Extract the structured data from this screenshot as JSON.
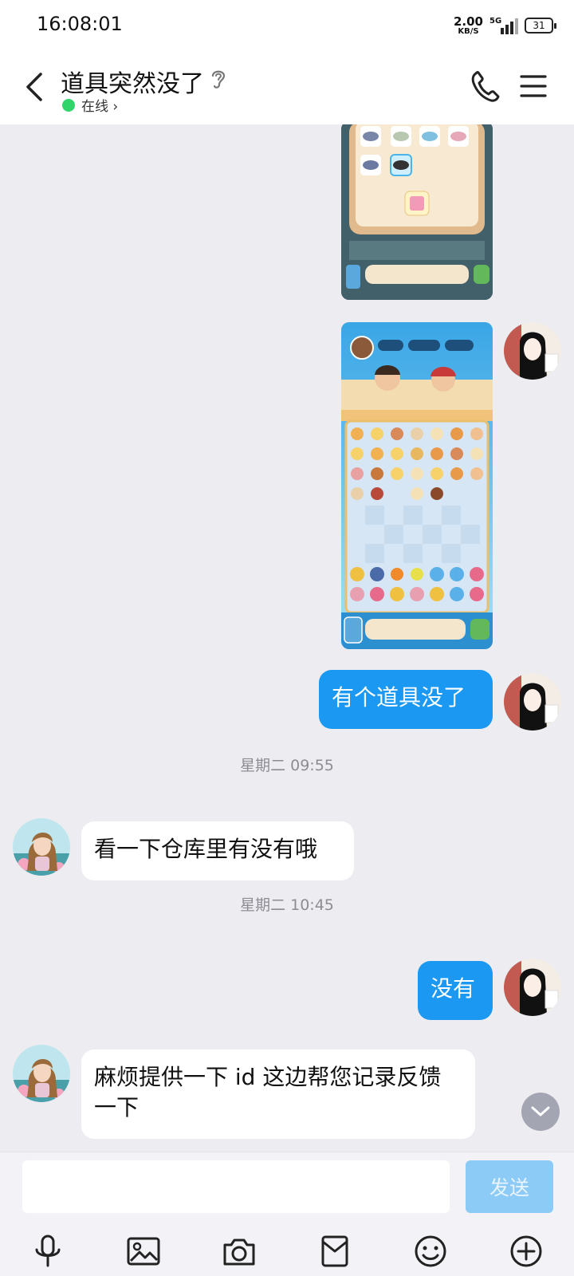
{
  "status_bar": {
    "time": "16:08:01",
    "net_speed_value": "2.00",
    "net_speed_unit": "KB/S",
    "network_type": "5G",
    "battery_level": "31"
  },
  "header": {
    "title": "道具突然没了",
    "status": "在线 ›"
  },
  "messages": {
    "time_1": "星期二 09:55",
    "time_2": "星期二 10:45",
    "me_1": "有个道具没了",
    "them_1": "看一下仓库里有没有哦",
    "me_2": "没有",
    "them_2": "麻烦提供一下 id 这边帮您记录反馈一下"
  },
  "input": {
    "placeholder": "",
    "send_label": "发送"
  },
  "colors": {
    "accent": "#1a98f2",
    "online": "#2fd46b",
    "send_disabled": "#8dcbf7"
  },
  "icons": [
    "back-arrow-icon",
    "ear-icon",
    "phone-icon",
    "menu-icon",
    "microphone-icon",
    "image-icon",
    "camera-icon",
    "red-packet-icon",
    "emoji-icon",
    "plus-icon",
    "chevron-down-icon"
  ]
}
